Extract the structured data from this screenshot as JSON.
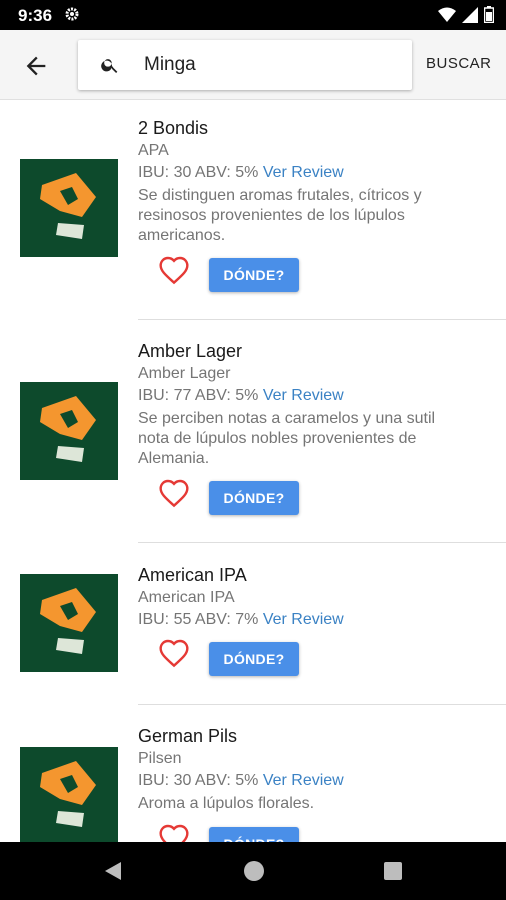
{
  "status_bar": {
    "time": "9:36"
  },
  "search": {
    "query": "Minga",
    "action_label": "BUSCAR"
  },
  "beers": [
    {
      "name": "2 Bondis",
      "style": "APA",
      "ibu_abv": "IBU: 30 ABV: 5%",
      "review_label": "Ver Review",
      "description": "Se distinguen aromas frutales, cítricos y resinosos provenientes de los lúpulos americanos.",
      "where_label": "DÓNDE?"
    },
    {
      "name": "Amber Lager",
      "style": "Amber Lager",
      "ibu_abv": "IBU: 77 ABV: 5%",
      "review_label": "Ver Review",
      "description": "Se perciben notas a caramelos y una sutil nota de lúpulos nobles provenientes de Alemania.",
      "where_label": "DÓNDE?"
    },
    {
      "name": "American IPA",
      "style": "American IPA",
      "ibu_abv": "IBU: 55 ABV: 7%",
      "review_label": "Ver Review",
      "description": "",
      "where_label": "DÓNDE?"
    },
    {
      "name": "German Pils",
      "style": "Pilsen",
      "ibu_abv": "IBU: 30 ABV: 5%",
      "review_label": "Ver Review",
      "description": "Aroma a lúpulos florales.",
      "where_label": "DÓNDE?"
    }
  ],
  "colors": {
    "thumb_bg": "#0d4a2c",
    "logo_orange": "#f4962f",
    "link_blue": "#3b82c4",
    "button_blue": "#4a8fe8",
    "heart_red": "#e53935"
  }
}
